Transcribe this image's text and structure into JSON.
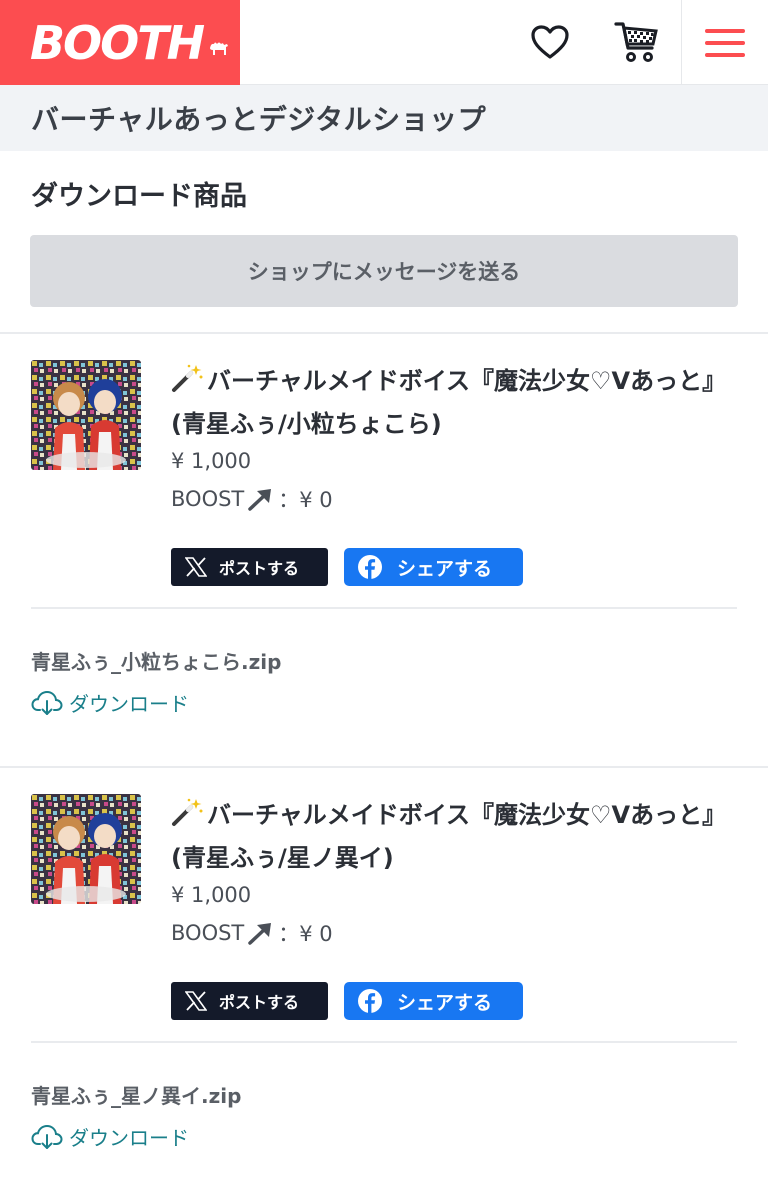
{
  "header": {
    "logo_text": "BOOTH",
    "brand_color": "#fc4d50",
    "icons": [
      "camel-icon",
      "heart-icon",
      "cart-icon",
      "hamburger-menu-icon"
    ]
  },
  "shop": {
    "name": "バーチャルあっとデジタルショップ"
  },
  "section_title": "ダウンロード商品",
  "message_button_label": "ショップにメッセージを送る",
  "items": [
    {
      "title": "バーチャルメイドボイス『魔法少女♡Vあっと』 (青星ふぅ/小粒ちょこら)",
      "price": "¥ 1,000",
      "boost_label": "BOOST",
      "boost_value": "：¥ 0",
      "post_label": "ポストする",
      "share_label": "シェアする",
      "file_name": "青星ふぅ_小粒ちょこら.zip",
      "download_label": "ダウンロード"
    },
    {
      "title": "バーチャルメイドボイス『魔法少女♡Vあっと』 (青星ふぅ/星ノ異イ)",
      "price": "¥ 1,000",
      "boost_label": "BOOST",
      "boost_value": "：¥ 0",
      "post_label": "ポストする",
      "share_label": "シェアする",
      "file_name": "青星ふぅ_星ノ異イ.zip",
      "download_label": "ダウンロード"
    }
  ],
  "colors": {
    "accent": "#fc4d50",
    "x_button": "#141a2a",
    "facebook_button": "#1877f2",
    "download_link": "#1a7f8a"
  }
}
